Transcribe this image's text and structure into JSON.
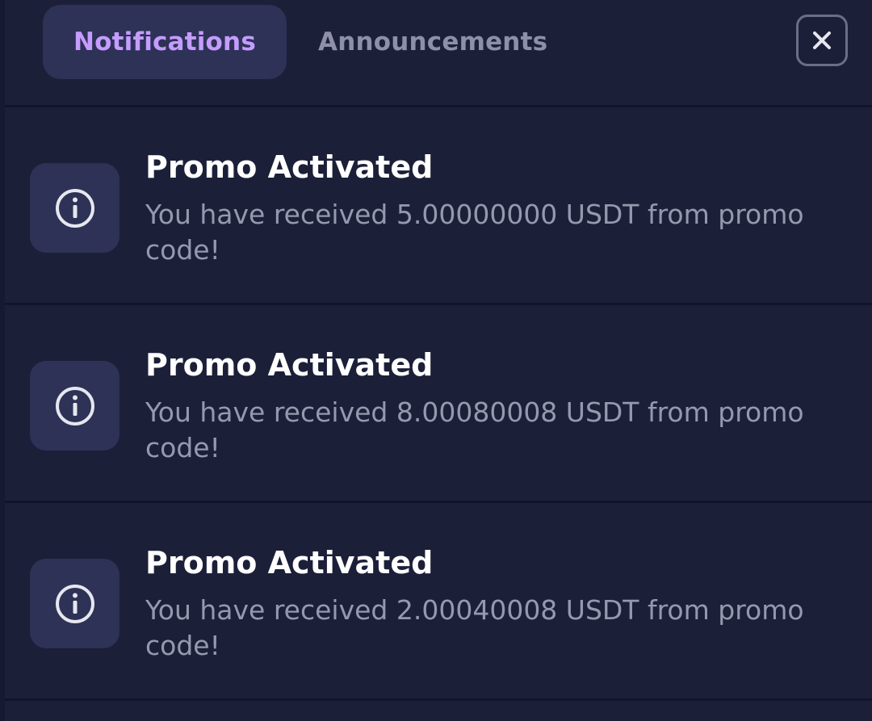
{
  "tabs": [
    {
      "label": "Notifications",
      "active": true
    },
    {
      "label": "Announcements",
      "active": false
    }
  ],
  "close_icon": "close-icon",
  "notifications": [
    {
      "icon": "info-icon",
      "title": "Promo Activated",
      "message": "You have received 5.00000000 USDT from promo code!"
    },
    {
      "icon": "info-icon",
      "title": "Promo Activated",
      "message": "You have received 8.00080008 USDT from promo code!"
    },
    {
      "icon": "info-icon",
      "title": "Promo Activated",
      "message": "You have received 2.00040008 USDT from promo code!"
    }
  ],
  "colors": {
    "background": "#1c1f38",
    "card": "#2d3256",
    "accent": "#c59cff",
    "muted_text": "#9699ad",
    "inactive_tab": "#8d90a6"
  }
}
